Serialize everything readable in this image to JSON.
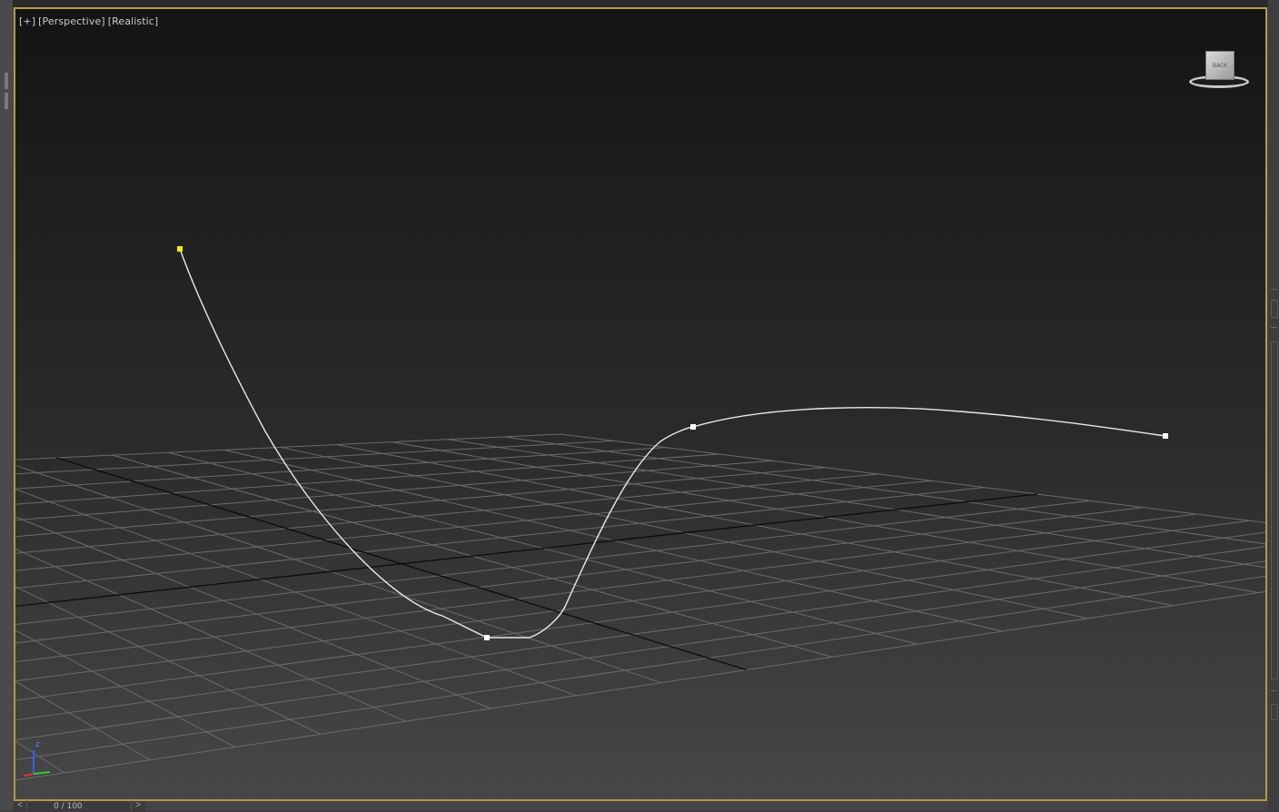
{
  "viewport": {
    "labels": [
      "[+]",
      "[Perspective]",
      "[Realistic]"
    ],
    "border_color": "#b39a49",
    "spline_color": "#e8e8e8",
    "first_vertex_color": "#f2f200",
    "vertex_color": "#ffffff",
    "viewcube": {
      "face_label": "BACK"
    },
    "axis_tripod": {
      "z_label": "z"
    }
  },
  "timebar": {
    "prev_icon": "chevron-left-icon",
    "next_icon": "chevron-right-icon",
    "frame_text": "0 / 100"
  }
}
